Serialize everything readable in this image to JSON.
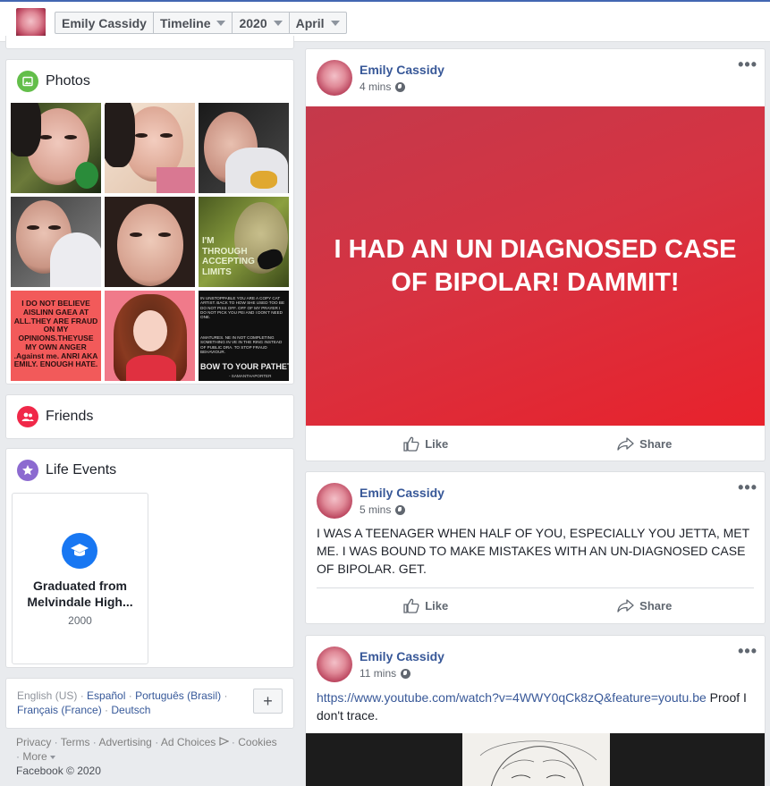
{
  "timeline_nav": {
    "name": "Emily Cassidy",
    "view": "Timeline",
    "year": "2020",
    "month": "April"
  },
  "sidebar": {
    "photos_title": "Photos",
    "photo_captions": {
      "p6": "I'M THROUGH ACCEPTING LIMITS",
      "p7": "I DO NOT BELIEVE AISLINN GAEA AT ALL.THEY ARE FRAUD ON MY OPINIONS.THEYUSE MY OWN ANGER .Against me. ANRI AKA EMILY. ENOUGH HATE.",
      "p9a": "IN UNSTOPPABLE YOU ARE A COPY CAT ARTIST. BACK TO HOW SHE USED TOO BE DO NOT PISS OFF. OFF OF MY PRAYER I DO NOT PICK YOU PEI AND I DON'T NEED ONE.",
      "p9b": "AMATURES. NE IN NOT COMPLETING SOMETHING IN VE IN THE RING INSTEAD OF PUBLIC DRA. TO STOP FRAUD BEHAVIOUR.",
      "p9c": "BOW TO YOUR PATHET",
      "p9d": "- SAMANTHAPORTER"
    },
    "friends_title": "Friends",
    "life_events_title": "Life Events",
    "life_event": {
      "title": "Graduated from Melvindale High...",
      "year": "2000"
    },
    "languages": [
      "English (US)",
      "Español",
      "Português (Brasil)",
      "Français (France)",
      "Deutsch"
    ],
    "add_language_label": "+",
    "footer_links": [
      "Privacy",
      "Terms",
      "Advertising",
      "Ad Choices",
      "Cookies",
      "More"
    ],
    "copyright": "Facebook © 2020"
  },
  "posts": [
    {
      "author": "Emily Cassidy",
      "time": "4 mins",
      "banner_text": "I HAD AN UN DIAGNOSED CASE OF BIPOLAR! DAMMIT!",
      "like_label": "Like",
      "share_label": "Share"
    },
    {
      "author": "Emily Cassidy",
      "time": "5 mins",
      "text": "I WAS A TEENAGER WHEN HALF OF YOU, ESPECIALLY YOU JETTA, MET ME. I WAS BOUND TO MAKE MISTAKES WITH AN UN-DIAGNOSED CASE OF BIPOLAR. GET.",
      "like_label": "Like",
      "share_label": "Share"
    },
    {
      "author": "Emily Cassidy",
      "time": "11 mins",
      "link": "https://www.youtube.com/watch?v=4WWY0qCk8zQ&feature=youtu.be",
      "text": "Proof I don't trace."
    }
  ],
  "colors": {
    "brand_link": "#385898",
    "banner_start": "#c4394b",
    "banner_end": "#e8222c",
    "photos_icon": "#63be4a",
    "friends_icon": "#f02849",
    "life_icon": "#8c6ad0",
    "grad_icon": "#1877f2"
  }
}
